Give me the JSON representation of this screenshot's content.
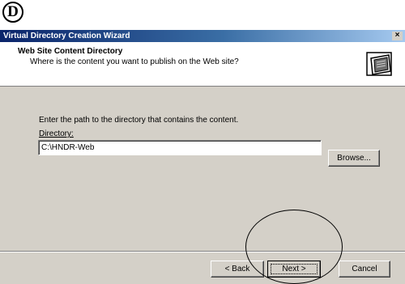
{
  "annotation": {
    "step_letter": "D"
  },
  "window": {
    "title": "Virtual Directory Creation Wizard",
    "close_glyph": "×"
  },
  "header": {
    "title": "Web Site Content Directory",
    "subtitle": "Where is the content you want to publish on the Web site?",
    "graphic_icon": "wizard-graphic-icon"
  },
  "content": {
    "instruction": "Enter the path to the directory that contains the content.",
    "directory_label": "Directory:",
    "directory_value": "C:\\HNDR-Web",
    "browse_label": "Browse..."
  },
  "buttons": {
    "back_label": "< Back",
    "next_label": "Next >",
    "cancel_label": "Cancel"
  },
  "colors": {
    "titlebar_start": "#0a246a",
    "titlebar_end": "#a6caf0",
    "dialog_face": "#d4d0c8"
  }
}
